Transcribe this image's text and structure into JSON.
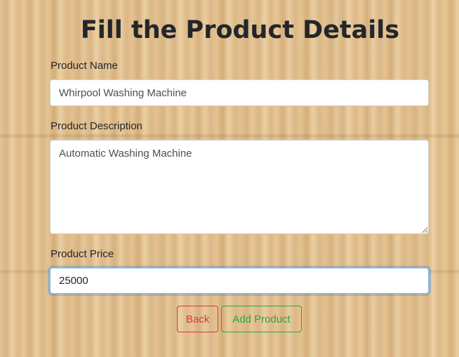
{
  "page": {
    "title": "Fill the Product Details"
  },
  "form": {
    "name_label": "Product Name",
    "name_value": "Whirpool Washing Machine",
    "description_label": "Product Description",
    "description_value": "Automatic Washing Machine",
    "price_label": "Product Price",
    "price_value": "25000"
  },
  "actions": {
    "back_label": "Back",
    "add_label": "Add Product"
  },
  "colors": {
    "back_button": "#dc3545",
    "add_button": "#28a745",
    "focus_ring": "#80bdff"
  }
}
